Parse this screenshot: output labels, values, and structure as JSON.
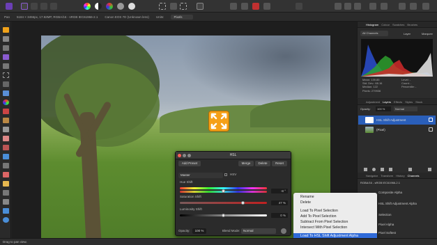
{
  "context_bar": {
    "size_info": "5184 × 3456px, 17.92MP, RGBA/16 - sRGB IEC61966-2.1",
    "camera": "Canon EOS 7D (Unknown lens)",
    "units_label": "Units:",
    "units_value": "Pixels"
  },
  "hsl_dialog": {
    "title": "HSL",
    "add_preset": "Add Preset",
    "merge": "Merge",
    "delete": "Delete",
    "reset": "Reset",
    "preset_select": "Master",
    "hsv_label": "HSV",
    "hue_label": "Hue Shift",
    "hue_value": "-8 °",
    "saturation_label": "Saturation Shift",
    "saturation_value": "47 %",
    "luminosity_label": "Luminosity Shift",
    "luminosity_value": "0 %",
    "opacity_label": "Opacity:",
    "opacity_value": "100 %",
    "blend_label": "Blend Mode:",
    "blend_value": "Normal"
  },
  "histogram_panel": {
    "tabs": [
      "Histogram",
      "Colour",
      "Swatches",
      "Brushes"
    ],
    "channel_select": "All Channels",
    "layer_label": "Layer",
    "marquee_label": "Marquee",
    "stats": [
      "Mean: 139.85",
      "Std. Dev.: 68.16",
      "Median: 122",
      "Pixels: 279936"
    ],
    "stats_right": [
      "Level: -",
      "Count: -",
      "Percentile: -"
    ]
  },
  "layers_panel": {
    "tabs": [
      "Adjustment",
      "Layers",
      "Effects",
      "Styles",
      "Stock"
    ],
    "opacity_label": "Opacity:",
    "opacity_value": "100 %",
    "blend_value": "Normal",
    "layers": [
      {
        "name": "HSL Shift Adjustment",
        "selected": true
      },
      {
        "name": "(Pixel)",
        "selected": false
      }
    ]
  },
  "channels_panel": {
    "tabs": [
      "Navigator",
      "Transform",
      "History",
      "Channels"
    ],
    "profile": "RGBA/16 - sRGB IEC61966-2.1",
    "rows": [
      "Composite Alpha",
      "HSL Shift Adjustment Alpha",
      "Selection",
      "Pixel Alpha",
      "Pixel Softest"
    ]
  },
  "context_menu": {
    "items": [
      {
        "label": "Rename",
        "selected": false
      },
      {
        "label": "Delete",
        "selected": false
      },
      {
        "label": "",
        "sep": true
      },
      {
        "label": "Load To Pixel Selection",
        "selected": false
      },
      {
        "label": "Add To Pixel Selection",
        "selected": false
      },
      {
        "label": "Subtract From Pixel Selection",
        "selected": false
      },
      {
        "label": "Intersect With Pixel Selection",
        "selected": false
      },
      {
        "label": "",
        "sep": true
      },
      {
        "label": "Load To HSL Shift Adjustment Alpha",
        "selected": true
      }
    ]
  },
  "status": "Drag to pan view."
}
